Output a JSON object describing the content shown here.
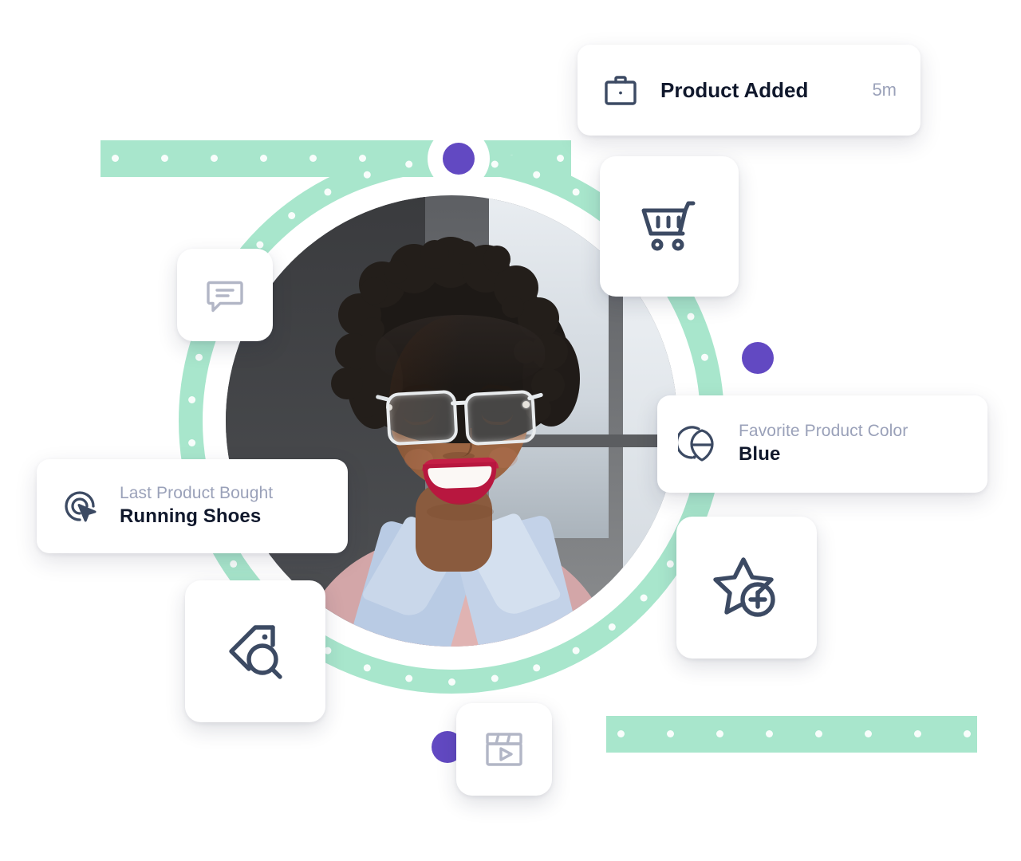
{
  "theme": {
    "ring_color": "#a8e6cc",
    "node_color": "#6249c2",
    "card_bg": "#ffffff",
    "label_color": "#9aa1b9",
    "value_color": "#10182c",
    "icon_dark": "#3c4a63",
    "icon_light": "#b2b6c6",
    "page_bg": "#ffffff"
  },
  "cards": {
    "product_added": {
      "icon": "briefcase-icon",
      "title": "Product Added",
      "time": "5m"
    },
    "favorite_color": {
      "icon": "color-picker-icon",
      "label": "Favorite Product Color",
      "value": "Blue"
    },
    "last_bought": {
      "icon": "click-target-icon",
      "label": "Last Product Bought",
      "value": "Running Shoes"
    }
  },
  "tiles": [
    {
      "id": "chat",
      "icon": "chat-bubble-icon"
    },
    {
      "id": "cart",
      "icon": "shopping-cart-icon"
    },
    {
      "id": "tag",
      "icon": "tag-search-icon"
    },
    {
      "id": "star",
      "icon": "star-add-icon"
    },
    {
      "id": "video",
      "icon": "video-clapperboard-icon"
    }
  ],
  "nodes": [
    {
      "id": "node-top",
      "color": "#6249c2"
    },
    {
      "id": "node-right",
      "color": "#6249c2"
    },
    {
      "id": "node-bottom",
      "color": "#6249c2"
    }
  ],
  "portrait": {
    "alt": "Smiling woman with glasses"
  }
}
